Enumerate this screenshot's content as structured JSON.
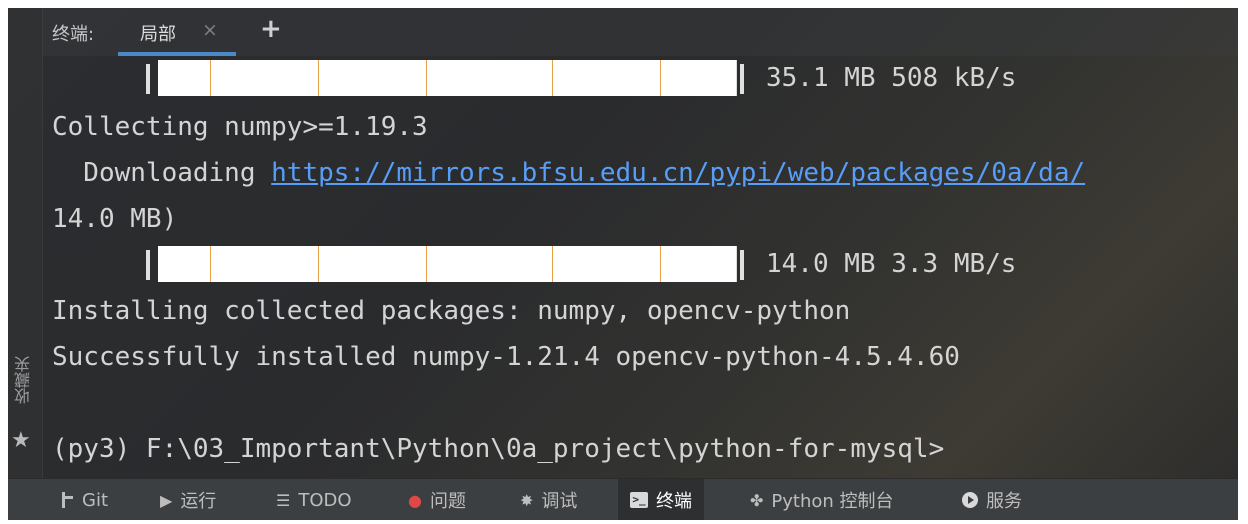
{
  "tabs": {
    "prefix": "终端:",
    "active_tab": "局部",
    "close_glyph": "×",
    "add_glyph": "+"
  },
  "side": {
    "bookmark_label": "收藏夹",
    "star_glyph": "★"
  },
  "terminal": {
    "progress1": {
      "text": "35.1 MB 508 kB/s",
      "percent": 100
    },
    "line_collecting": "Collecting numpy>=1.19.3",
    "downloading_prefix": "  Downloading ",
    "downloading_url": "https://mirrors.bfsu.edu.cn/pypi/web/packages/0a/da/",
    "line_size": "14.0 MB)",
    "progress2": {
      "text": "14.0 MB 3.3 MB/s",
      "percent": 100
    },
    "line_installing": "Installing collected packages: numpy, opencv-python",
    "line_success": "Successfully installed numpy-1.21.4 opencv-python-4.5.4.60",
    "prompt": "(py3) F:\\03_Important\\Python\\0a_project\\python-for-mysql>"
  },
  "statusbar": {
    "git": "Git",
    "run": "运行",
    "todo": "TODO",
    "problems": "问题",
    "debug": "调试",
    "terminal": "终端",
    "python_console": "Python 控制台",
    "services": "服务"
  },
  "colors": {
    "link": "#589df6",
    "tab_underline": "#4a88c7",
    "progress_tick": "#e6a14a"
  },
  "icons": {
    "git": "git-branch-icon",
    "run": "play-icon",
    "todo": "list-icon",
    "problems": "error-icon",
    "debug": "bug-icon",
    "terminal": "terminal-icon",
    "python_console": "python-icon",
    "services": "services-icon"
  }
}
